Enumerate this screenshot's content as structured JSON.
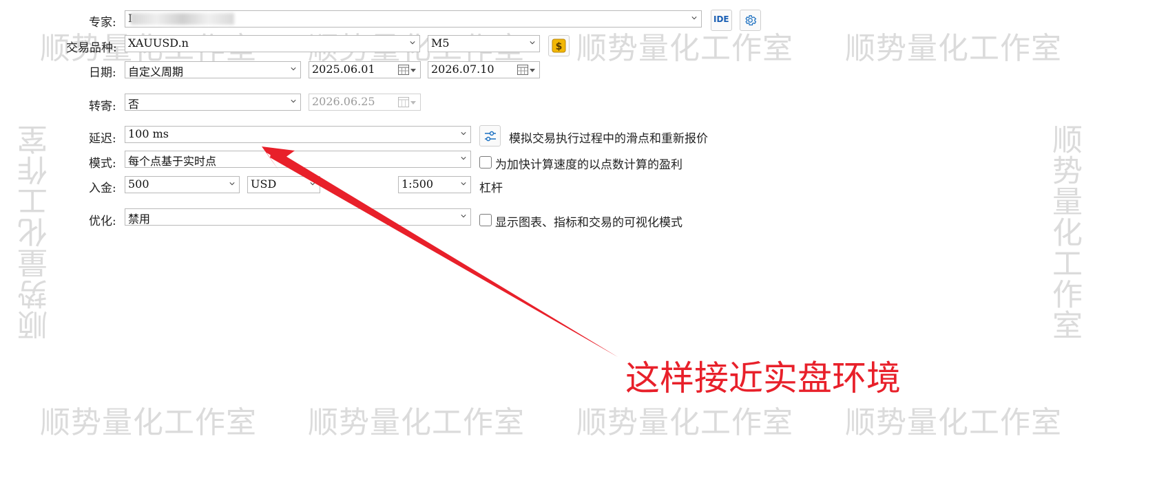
{
  "watermark": "顺势量化工作室",
  "form": {
    "expert": {
      "label": "专家:",
      "value": "I"
    },
    "symbol": {
      "label": "交易品种:",
      "value": "XAUUSD.n",
      "timeframe": "M5"
    },
    "date": {
      "label": "日期:",
      "period": "自定义周期",
      "from": "2025.06.01",
      "to": "2026.07.10"
    },
    "forward": {
      "label": "转寄:",
      "value": "否",
      "date": "2026.06.25"
    },
    "delay": {
      "label": "延迟:",
      "value": "100 ms",
      "description": "模拟交易执行过程中的滑点和重新报价"
    },
    "mode": {
      "label": "模式:",
      "value": "每个点基于实时点",
      "checkbox_label": "为加快计算速度的以点数计算的盈利"
    },
    "deposit": {
      "label": "入金:",
      "value": "500",
      "currency": "USD",
      "leverage": "1:500",
      "leverage_label": "杠杆"
    },
    "optimization": {
      "label": "优化:",
      "value": "禁用",
      "checkbox_label": "显示图表、指标和交易的可视化模式"
    }
  },
  "buttons": {
    "ide_label": "IDE"
  },
  "annotation": {
    "text": "这样接近实盘环境",
    "color": "#e8202a"
  },
  "icons": [
    "settings-gear-icon",
    "dollar-coin-icon",
    "calendar-icon",
    "sliders-icon",
    "chevron-down-icon",
    "red-arrow"
  ]
}
